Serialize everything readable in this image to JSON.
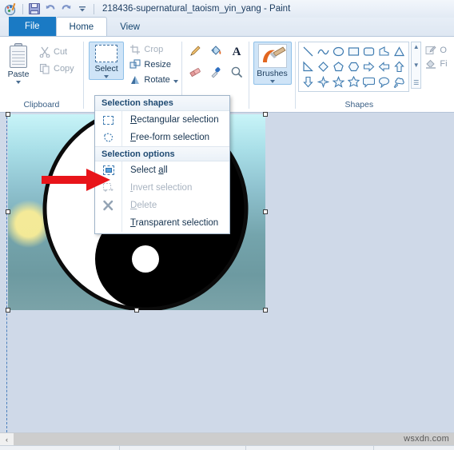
{
  "window": {
    "title": "218436-supernatural_taoism_yin_yang - Paint",
    "app_icon": "paint-palette-icon",
    "quick_access": [
      {
        "name": "save-button",
        "icon": "floppy-disk-icon",
        "label": "Save"
      },
      {
        "name": "undo-button",
        "icon": "undo-arrow-icon",
        "label": "Undo"
      },
      {
        "name": "redo-button",
        "icon": "redo-arrow-icon",
        "label": "Redo"
      },
      {
        "name": "customize-qat-button",
        "icon": "chevron-down-icon",
        "label": "Customize Quick Access Toolbar"
      }
    ]
  },
  "tabs": [
    {
      "label": "File",
      "state": "file"
    },
    {
      "label": "Home",
      "state": "active"
    },
    {
      "label": "View",
      "state": "normal"
    }
  ],
  "ribbon": {
    "groups": [
      {
        "name": "clipboard",
        "label": "Clipboard",
        "paste": {
          "label": "Paste",
          "icon": "clipboard-icon"
        },
        "commands": [
          {
            "label": "Cut",
            "icon": "scissors-icon",
            "enabled": false
          },
          {
            "label": "Copy",
            "icon": "copy-icon",
            "enabled": false
          }
        ]
      },
      {
        "name": "image",
        "label": "Selection shapes",
        "select": {
          "label": "Select",
          "icon": "dashed-rectangle-icon",
          "active": true
        },
        "commands": [
          {
            "label": "Crop",
            "icon": "crop-icon",
            "enabled": false
          },
          {
            "label": "Resize",
            "icon": "resize-icon",
            "enabled": true
          },
          {
            "label": "Rotate",
            "icon": "rotate-icon",
            "enabled": true
          }
        ]
      },
      {
        "name": "tools",
        "label": "",
        "tools": [
          {
            "name": "pencil-tool",
            "icon": "pencil-icon"
          },
          {
            "name": "fill-tool",
            "icon": "paint-bucket-icon"
          },
          {
            "name": "text-tool",
            "icon": "text-a-icon"
          },
          {
            "name": "eraser-tool",
            "icon": "eraser-icon"
          },
          {
            "name": "color-picker-tool",
            "icon": "eyedropper-icon"
          },
          {
            "name": "magnifier-tool",
            "icon": "magnifier-icon"
          }
        ]
      },
      {
        "name": "brushes",
        "label": "",
        "brushes": {
          "label": "Brushes",
          "icon": "paintbrush-icon",
          "active": true
        }
      },
      {
        "name": "shapes",
        "label": "Shapes",
        "items": [
          "line-shape",
          "curve-shape",
          "oval-shape",
          "rectangle-shape",
          "rounded-rectangle-shape",
          "polygon-shape",
          "triangle-shape",
          "right-triangle-shape",
          "diamond-shape",
          "pentagon-shape",
          "hexagon-shape",
          "right-arrow-shape",
          "left-arrow-shape",
          "up-arrow-shape",
          "down-arrow-shape",
          "four-point-star-shape",
          "five-point-star-shape",
          "six-point-star-shape",
          "rounded-callout-shape",
          "oval-callout-shape",
          "cloud-callout-shape"
        ],
        "scroll": {
          "up": "▲",
          "down": "▼",
          "more": "☰"
        }
      },
      {
        "name": "colors",
        "label": "",
        "items": [
          {
            "label": "O",
            "icon": "outline-pencil-icon",
            "enabled": false
          },
          {
            "label": "Fi",
            "icon": "fill-bucket-icon",
            "enabled": false
          }
        ]
      }
    ]
  },
  "menu": {
    "name": "select-dropdown-menu",
    "sections": [
      {
        "header": "Selection shapes",
        "items": [
          {
            "label": "Rectangular selection",
            "accel": "R",
            "icon": "dashed-rectangle-icon",
            "enabled": true
          },
          {
            "label": "Free-form selection",
            "accel": "F",
            "icon": "dashed-freeform-icon",
            "enabled": true
          }
        ]
      },
      {
        "header": "Selection options",
        "items": [
          {
            "label": "Select all",
            "accel": "a",
            "icon": "select-all-icon",
            "enabled": true
          },
          {
            "label": "Invert selection",
            "accel": "I",
            "icon": "invert-selection-icon",
            "enabled": false
          },
          {
            "label": "Delete",
            "accel": "D",
            "icon": "delete-x-icon",
            "enabled": false
          },
          {
            "label": "Transparent selection",
            "accel": "T",
            "icon": "none",
            "enabled": true
          }
        ]
      }
    ]
  },
  "canvas": {
    "name": "image-canvas",
    "image_alt": "yin-yang-symbol",
    "selection_active": true,
    "handles": 8
  },
  "annotation": {
    "name": "red-arrow-annotation",
    "color": "#e8141a",
    "points_to": "Select all"
  },
  "scrollbar": {
    "left_arrow": "‹",
    "right_arrow": "›"
  },
  "watermark": {
    "text": "wsxdn.com"
  },
  "colors": {
    "accent": "#1a7ac4",
    "ribbon_bg": "#ffffff",
    "workarea_bg": "#cfd9e8",
    "selection_highlight": "#cfe4f7",
    "annotation_red": "#e8141a"
  }
}
